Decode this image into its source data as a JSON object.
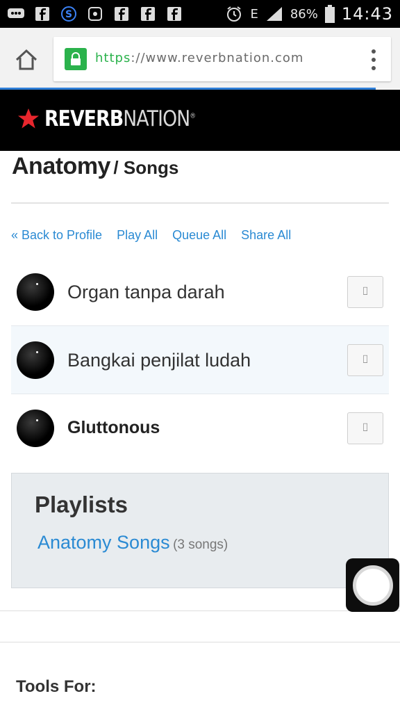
{
  "status_bar": {
    "left_icons": [
      "message-icon",
      "facebook-icon",
      "skype-icon",
      "screen-icon",
      "facebook-icon",
      "facebook-icon",
      "facebook-icon"
    ],
    "network_type": "E",
    "battery": "86%",
    "time": "14:43"
  },
  "browser": {
    "url_scheme": "https",
    "url_rest": "://www.reverbnation.com",
    "progress": 0.94
  },
  "site": {
    "logo_part1": "REVERB",
    "logo_part2": "NATION",
    "logo_mark": "®",
    "brand_color": "#e8262d"
  },
  "page": {
    "artist": "Anatomy",
    "section": "/ Songs"
  },
  "actions": {
    "back": "« Back to Profile",
    "play_all": "Play All",
    "queue_all": "Queue All",
    "share_all": "Share All"
  },
  "songs": [
    {
      "title": "Organ tanpa darah",
      "button_glyph": "⌷"
    },
    {
      "title": "Bangkai penjilat ludah",
      "button_glyph": "⌷"
    },
    {
      "title": "Gluttonous",
      "button_glyph": "⌷"
    }
  ],
  "playlists": {
    "heading": "Playlists",
    "items": [
      {
        "name": "Anatomy Songs",
        "count": "(3 songs)"
      }
    ]
  },
  "footer": {
    "tools_heading": "Tools For:"
  }
}
